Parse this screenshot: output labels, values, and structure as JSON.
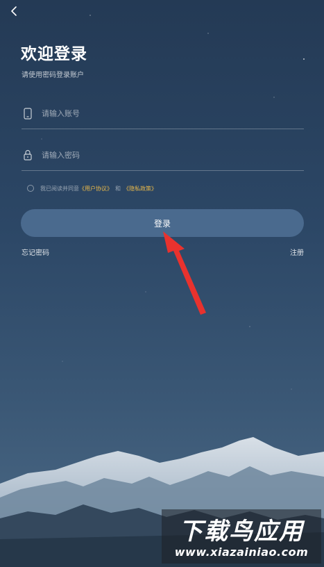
{
  "header": {
    "back_icon": "chevron-left-icon"
  },
  "login": {
    "title": "欢迎登录",
    "subtitle": "请使用密码登录账户",
    "account_placeholder": "请输入账号",
    "account_icon": "phone-icon",
    "password_placeholder": "请输入密码",
    "password_icon": "lock-icon",
    "agreement": {
      "prefix": "我已阅读并同意",
      "user_agreement": "《用户协议》",
      "and": "和",
      "privacy_policy": "《隐私政策》",
      "checked": false
    },
    "submit_label": "登录",
    "forgot_label": "忘记密码",
    "register_label": "注册"
  },
  "watermark": {
    "brand": "下载鸟应用",
    "url": "www.xiazainiao.com"
  },
  "colors": {
    "background_top": "#243a55",
    "background_bottom": "#4c6a86",
    "button": "#4a6a8e",
    "link": "#e8b84a",
    "annotation_arrow": "#e8322e"
  }
}
